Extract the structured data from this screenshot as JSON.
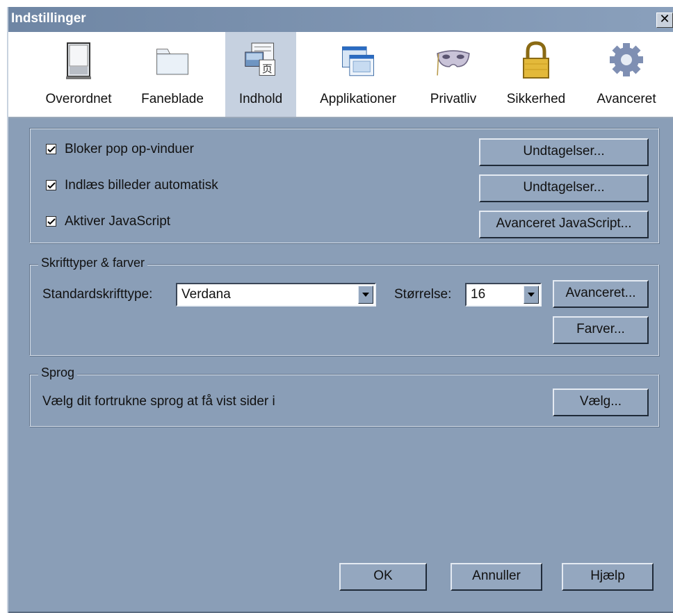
{
  "window": {
    "title": "Indstillinger",
    "close_glyph": "✕"
  },
  "toolbar": {
    "items": [
      {
        "label": "Overordnet",
        "icon": "general-icon"
      },
      {
        "label": "Faneblade",
        "icon": "tabs-icon"
      },
      {
        "label": "Indhold",
        "icon": "content-icon",
        "active": true
      },
      {
        "label": "Applikationer",
        "icon": "applications-icon"
      },
      {
        "label": "Privatliv",
        "icon": "privacy-mask-icon"
      },
      {
        "label": "Sikkerhed",
        "icon": "lock-icon"
      },
      {
        "label": "Avanceret",
        "icon": "gear-icon"
      }
    ]
  },
  "content": {
    "popups": {
      "label": "Bloker pop op-vinduer",
      "checked": true,
      "button": "Undtagelser..."
    },
    "images": {
      "label": "Indlæs billeder automatisk",
      "checked": true,
      "button": "Undtagelser..."
    },
    "javascript": {
      "label": "Aktiver JavaScript",
      "checked": true,
      "button": "Avanceret JavaScript..."
    }
  },
  "fonts": {
    "legend": "Skrifttyper & farver",
    "default_font_label": "Standardskrifttype:",
    "default_font_value": "Verdana",
    "size_label": "Størrelse:",
    "size_value": "16",
    "advanced_button": "Avanceret...",
    "colors_button": "Farver..."
  },
  "language": {
    "legend": "Sprog",
    "description": "Vælg dit fortrukne sprog at få vist sider i",
    "choose_button": "Vælg..."
  },
  "footer": {
    "ok": "OK",
    "cancel": "Annuller",
    "help": "Hjælp"
  }
}
